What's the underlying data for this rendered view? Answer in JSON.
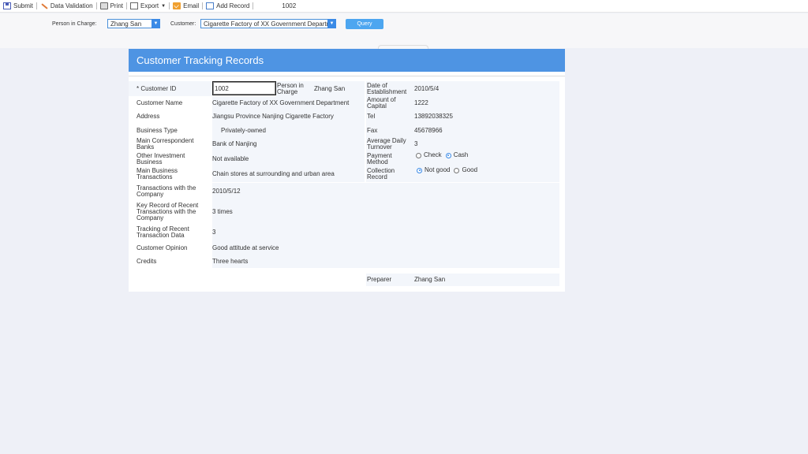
{
  "toolbar": {
    "submit": "Submit",
    "validation": "Data Validation",
    "print": "Print",
    "export": "Export",
    "email": "Email",
    "add_record": "Add Record",
    "record_id": "1002"
  },
  "filters": {
    "person_label": "Person in Charge:",
    "person_value": "Zhang San",
    "customer_label": "Customer:",
    "customer_value": "Cigarette Factory of XX Government Department",
    "query": "Query"
  },
  "form": {
    "title": "Customer Tracking Records",
    "customer_id_label": "* Customer ID",
    "customer_id": "1002",
    "person_label": "Person in Charge",
    "person": "Zhang San",
    "date_label": "Date of Establishment",
    "date": "2010/5/4",
    "name_label": "Customer Name",
    "name": "Cigarette Factory of XX Government Department",
    "capital_label": "Amount of Capital",
    "capital": "1222",
    "address_label": "Address",
    "address": "Jiangsu Province Nanjing Cigarette Factory",
    "tel_label": "Tel",
    "tel": "13892038325",
    "btype_label": "Business Type",
    "btype": "Privately-owned",
    "fax_label": "Fax",
    "fax": "45678966",
    "banks_label": "Main Correspondent Banks",
    "banks": "Bank of Nanjing",
    "turnover_label": "Average Daily Turnover",
    "turnover": "3",
    "invest_label": "Other Investment Business",
    "invest": "Not available",
    "payment_label": "Payment Method",
    "payment_check": "Check",
    "payment_cash": "Cash",
    "transactions_label": "Main Business Transactions",
    "transactions": "Chain stores at surrounding and urban area",
    "collection_label": "Collection Record",
    "collection_notgood": "Not good",
    "collection_good": "Good",
    "with_company_label": "Transactions with the Company",
    "with_company": "2010/5/12",
    "key_record_label": "Key Record of Recent Transactions with the Company",
    "key_record": "3 times",
    "tracking_label": "Tracking of Recent Transaction Data",
    "tracking": "3",
    "opinion_label": "Customer Opinion",
    "opinion": "Good attitude at service",
    "credits_label": "Credits",
    "credits": "Three hearts",
    "preparer_label": "Preparer",
    "preparer": "Zhang San"
  },
  "colors": {
    "header": "#4e94e3",
    "accent": "#3b8ae6",
    "query": "#4da6f0"
  }
}
